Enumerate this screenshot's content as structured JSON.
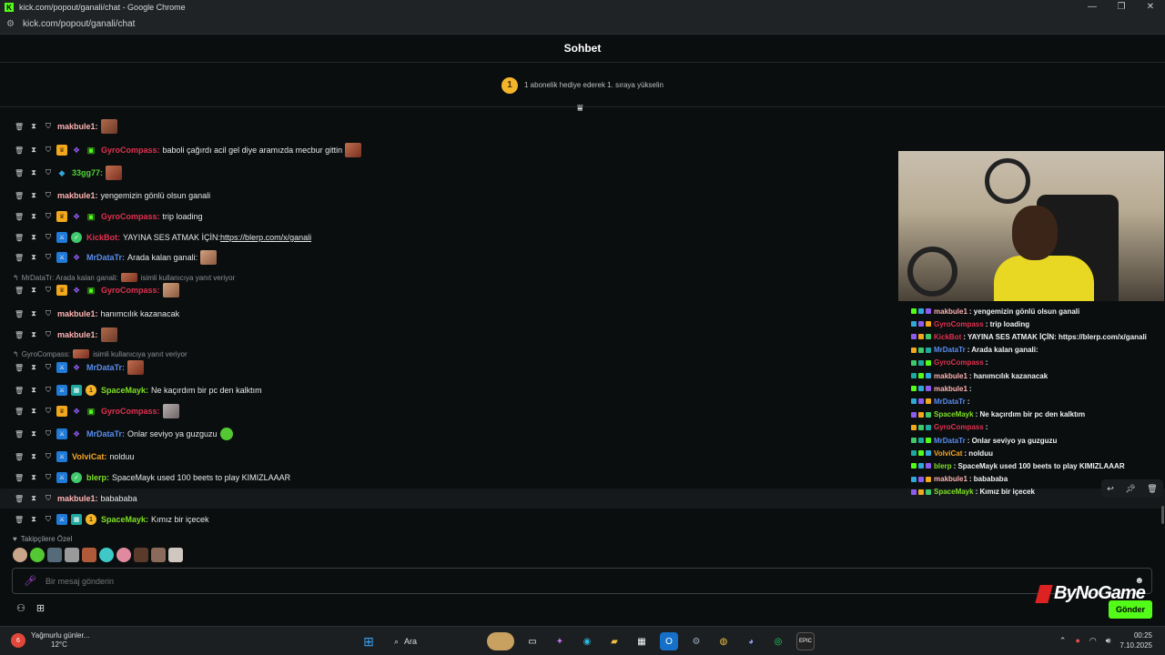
{
  "window": {
    "title": "kick.com/popout/ganali/chat - Google Chrome",
    "url": "kick.com/popout/ganali/chat",
    "controls": [
      "—",
      "❐",
      "✕"
    ]
  },
  "chat": {
    "header": "Sohbet",
    "banner_rank": "1",
    "banner_text": "1 abonelik hediye ederek 1. sıraya yükselin",
    "messages": [
      {
        "user": "makbule1",
        "color": "#ffb3b3",
        "text": "",
        "badges": []
      },
      {
        "user": "GyroCompass",
        "color": "#e0314f",
        "text": "baboli çağırdı acil gel diye aramızda mecbur gittin",
        "badges": [
          "crown",
          "purple",
          "gift"
        ]
      },
      {
        "user": "33gg77",
        "color": "#52d13b",
        "text": "",
        "badges": [
          "cyan"
        ]
      },
      {
        "user": "makbule1",
        "color": "#ffb3b3",
        "text": "yengemizin gönlü olsun ganali",
        "badges": []
      },
      {
        "user": "GyroCompass",
        "color": "#e0314f",
        "text": "trip loading",
        "badges": [
          "crown",
          "purple",
          "gift"
        ]
      },
      {
        "user": "KickBot",
        "color": "#e0314f",
        "text": "YAYINA SES ATMAK İÇİN: ",
        "link": "https://blerp.com/x/ganali",
        "badges": [
          "blue",
          "green"
        ]
      },
      {
        "user": "MrDataTr",
        "color": "#5a8dee",
        "text": "Arada kalan ganali:",
        "badges": [
          "blue",
          "purple"
        ]
      },
      {
        "user": "GyroCompass",
        "color": "#e0314f",
        "text": "",
        "badges": [
          "crown",
          "purple",
          "gift"
        ]
      },
      {
        "user": "makbule1",
        "color": "#ffb3b3",
        "text": "hanımcılık kazanacak",
        "badges": []
      },
      {
        "user": "makbule1",
        "color": "#ffb3b3",
        "text": "",
        "badges": []
      },
      {
        "user": "MrDataTr",
        "color": "#5a8dee",
        "text": "",
        "badges": [
          "blue",
          "purple"
        ]
      },
      {
        "user": "SpaceMayk",
        "color": "#7ee026",
        "text": "Ne kaçırdım bir pc den kalktım",
        "badges": [
          "blue",
          "teal",
          "gold"
        ]
      },
      {
        "user": "GyroCompass",
        "color": "#e0314f",
        "text": "",
        "badges": [
          "crown",
          "purple",
          "gift"
        ]
      },
      {
        "user": "MrDataTr",
        "color": "#5a8dee",
        "text": "Onlar seviyo ya guzguzu",
        "badges": [
          "blue",
          "purple"
        ]
      },
      {
        "user": "VolviCat",
        "color": "#f5a524",
        "text": "nolduu",
        "badges": [
          "blue"
        ]
      },
      {
        "user": "blerp",
        "color": "#7ee026",
        "text": "SpaceMayk used 100 beets to play KIMIZLAAAR",
        "badges": [
          "blue",
          "green"
        ]
      },
      {
        "user": "makbule1",
        "color": "#ffb3b3",
        "text": "babababa",
        "badges": []
      },
      {
        "user": "SpaceMayk",
        "color": "#7ee026",
        "text": "Kımız bir içecek",
        "badges": [
          "blue",
          "teal",
          "gold"
        ]
      }
    ],
    "replies": [
      {
        "text": "MrDataTr: Arada kalan ganali:",
        "suffix": "isimli kullanıcıya yanıt veriyor"
      },
      {
        "text": "GyroCompass:",
        "suffix": "isimli kullanıcıya yanıt veriyor"
      }
    ],
    "followers_label": "Takipçilere Özel",
    "input_placeholder": "Bir mesaj gönderin",
    "send_label": "Gönder"
  },
  "brand": "ByNoGame",
  "overlay_chat": [
    {
      "user": "makbule1",
      "color": "#ffb3b3",
      "text": ": yengemizin gönlü olsun ganali"
    },
    {
      "user": "GyroCompass",
      "color": "#e0314f",
      "text": ": trip loading"
    },
    {
      "user": "KickBot",
      "color": "#e0314f",
      "text": ": YAYINA SES ATMAK İÇİN: https://blerp.com/x/ganali"
    },
    {
      "user": "MrDataTr",
      "color": "#5a8dee",
      "text": ": Arada kalan ganali:"
    },
    {
      "user": "GyroCompass",
      "color": "#e0314f",
      "text": ":"
    },
    {
      "user": "makbule1",
      "color": "#ffb3b3",
      "text": ": hanımcılık kazanacak"
    },
    {
      "user": "makbule1",
      "color": "#ffb3b3",
      "text": ":"
    },
    {
      "user": "MrDataTr",
      "color": "#5a8dee",
      "text": ":"
    },
    {
      "user": "SpaceMayk",
      "color": "#7ee026",
      "text": ": Ne kaçırdım bir pc den kalktım"
    },
    {
      "user": "GyroCompass",
      "color": "#e0314f",
      "text": ":"
    },
    {
      "user": "MrDataTr",
      "color": "#5a8dee",
      "text": ": Onlar seviyo ya guzguzu"
    },
    {
      "user": "VolviCat",
      "color": "#f5a524",
      "text": ": nolduu"
    },
    {
      "user": "blerp",
      "color": "#7ee026",
      "text": ": SpaceMayk used 100 beets to play KIMIZLAAAR"
    },
    {
      "user": "makbule1",
      "color": "#ffb3b3",
      "text": ": babababa"
    },
    {
      "user": "SpaceMayk",
      "color": "#7ee026",
      "text": ": Kımız bir içecek"
    }
  ],
  "taskbar": {
    "weather_title": "Yağmurlu günler...",
    "weather_temp": "12°C",
    "weather_badge": "6",
    "search_label": "Ara",
    "time": "00:25",
    "date": "7.10.2025"
  }
}
